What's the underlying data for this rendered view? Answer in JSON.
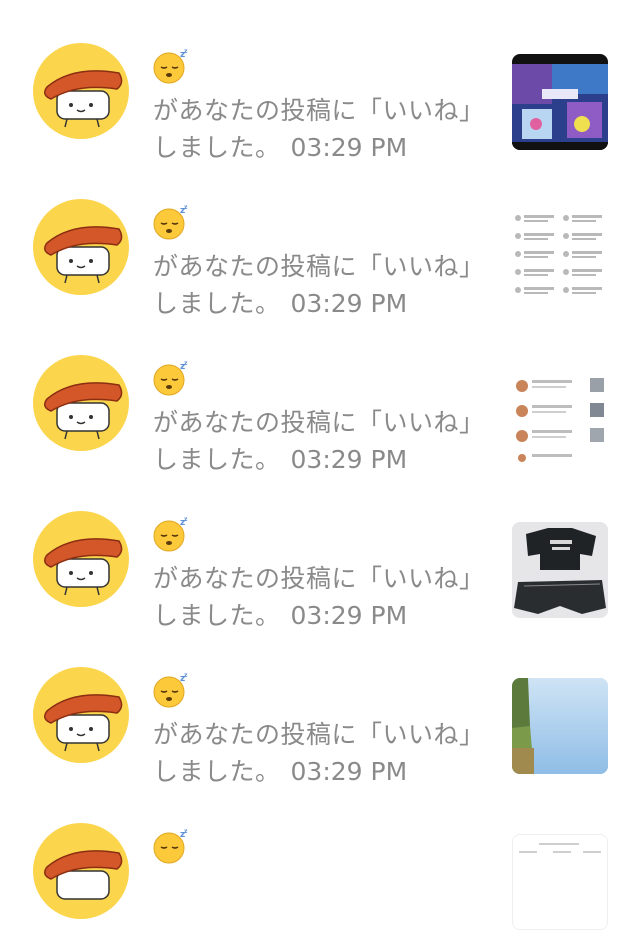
{
  "notifications": [
    {
      "status_icon": "sleepy-face-icon",
      "text": "があなたの投稿に「いいね」しました。",
      "time": "03:29 PM",
      "thumbnail": "game-screenshot-thumbnail"
    },
    {
      "status_icon": "sleepy-face-icon",
      "text": "があなたの投稿に「いいね」しました。",
      "time": "03:29 PM",
      "thumbnail": "notification-list-screenshot-thumbnail"
    },
    {
      "status_icon": "sleepy-face-icon",
      "text": "があなたの投稿に「いいね」しました。",
      "time": "03:29 PM",
      "thumbnail": "notification-list-screenshot-thumbnail"
    },
    {
      "status_icon": "sleepy-face-icon",
      "text": "があなたの投稿に「いいね」しました。",
      "time": "03:29 PM",
      "thumbnail": "black-clothes-photo-thumbnail"
    },
    {
      "status_icon": "sleepy-face-icon",
      "text": "があなたの投稿に「いいね」しました。",
      "time": "03:29 PM",
      "thumbnail": "sky-landscape-photo-thumbnail"
    },
    {
      "status_icon": "sleepy-face-icon",
      "text": "",
      "time": "",
      "thumbnail": "document-thumbnail"
    }
  ],
  "colors": {
    "avatar_bg": "#fbd54c",
    "text_gray": "#8a8a8a",
    "salmon": "#d4572a",
    "background": "#ffffff"
  }
}
